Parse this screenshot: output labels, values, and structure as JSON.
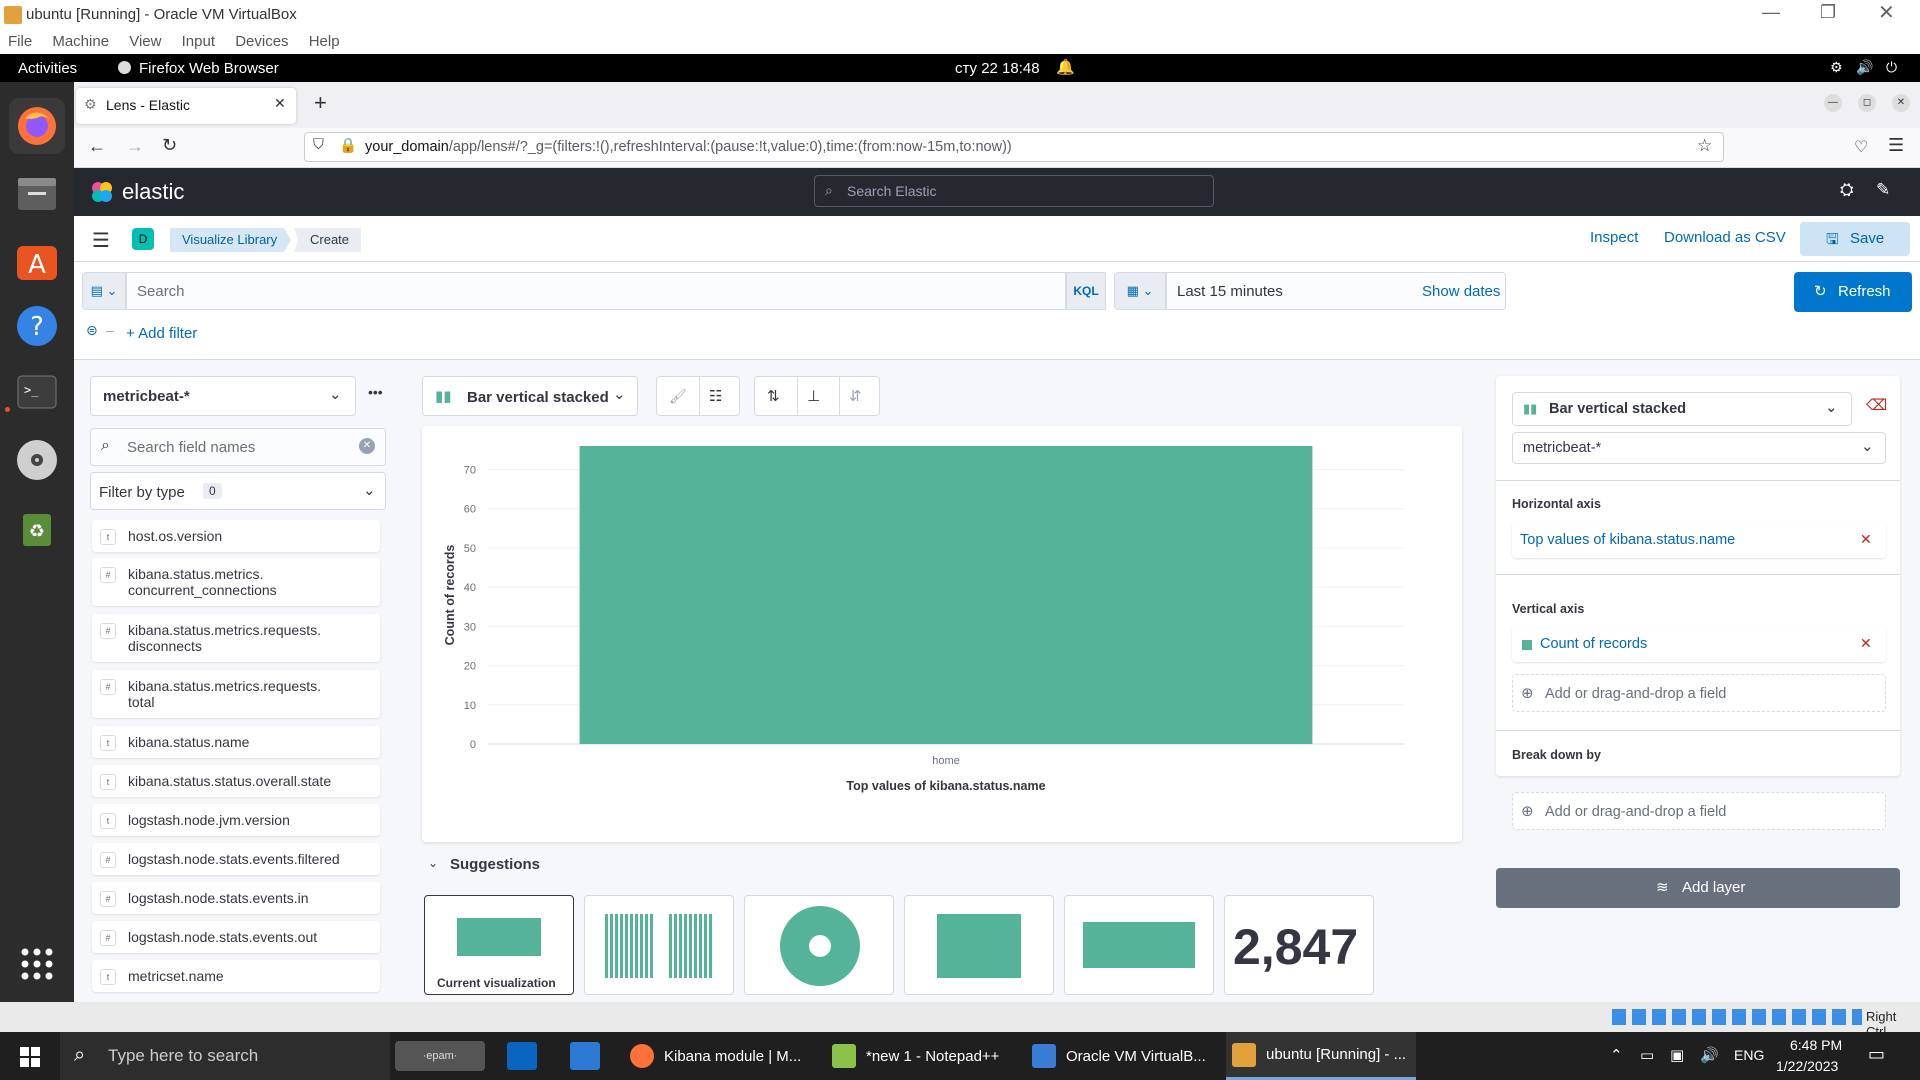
{
  "vbox": {
    "title": "ubuntu [Running] - Oracle VM VirtualBox",
    "menu": [
      "File",
      "Machine",
      "View",
      "Input",
      "Devices",
      "Help"
    ],
    "host_key": "Right Ctrl"
  },
  "gnome": {
    "activities": "Activities",
    "app": "Firefox Web Browser",
    "clock": "сту 22  18:48"
  },
  "browser": {
    "tab_title": "Lens - Elastic",
    "url_domain": "your_domain",
    "url_path": "/app/lens#/?_g=(filters:!(),refreshInterval:(pause:!t,value:0),time:(from:now-15m,to:now))"
  },
  "elastic": {
    "logo_text": "elastic",
    "search_placeholder": "Search Elastic",
    "space_badge": "D",
    "breadcrumbs": [
      "Visualize Library",
      "Create"
    ],
    "actions": {
      "inspect": "Inspect",
      "download_csv": "Download as CSV",
      "save": "Save"
    },
    "query": {
      "search_placeholder": "Search",
      "kql": "KQL",
      "time_range": "Last 15 minutes",
      "show_dates": "Show dates",
      "refresh": "Refresh",
      "add_filter": "+ Add filter"
    }
  },
  "datasource": {
    "index_pattern": "metricbeat-*",
    "field_search_placeholder": "Search field names",
    "filter_by_type": "Filter by type",
    "filter_count": "0",
    "fields": [
      {
        "type": "t",
        "name": "host.os.version"
      },
      {
        "type": "#",
        "name": "kibana.status.metrics.\nconcurrent_connections"
      },
      {
        "type": "#",
        "name": "kibana.status.metrics.requests.\ndisconnects"
      },
      {
        "type": "#",
        "name": "kibana.status.metrics.requests.\ntotal"
      },
      {
        "type": "t",
        "name": "kibana.status.name"
      },
      {
        "type": "t",
        "name": "kibana.status.status.overall.state"
      },
      {
        "type": "t",
        "name": "logstash.node.jvm.version"
      },
      {
        "type": "#",
        "name": "logstash.node.stats.events.filtered"
      },
      {
        "type": "#",
        "name": "logstash.node.stats.events.in"
      },
      {
        "type": "#",
        "name": "logstash.node.stats.events.out"
      },
      {
        "type": "t",
        "name": "metricset.name"
      }
    ]
  },
  "workspace": {
    "chart_type_label": "Bar vertical stacked",
    "suggestions_title": "Suggestions",
    "suggestion_current_label": "Current visualization",
    "suggestion_metric_value": "2,847"
  },
  "config_panel": {
    "chart_type_label": "Bar vertical stacked",
    "index_pattern": "metricbeat-*",
    "horizontal_axis_title": "Horizontal axis",
    "horizontal_axis_value": "Top values of kibana.status.name",
    "vertical_axis_title": "Vertical axis",
    "vertical_axis_value": "Count of records",
    "add_field": "Add or drag-and-drop a field",
    "break_down_title": "Break down by",
    "add_layer": "Add layer"
  },
  "taskbar": {
    "search_placeholder": "Type here to search",
    "tasks": [
      "Kibana module | M...",
      "*new 1 - Notepad++",
      "Oracle VM VirtualB...",
      "ubuntu [Running] - ..."
    ],
    "lang": "ENG",
    "time": "6:48 PM",
    "date": "1/22/2023"
  },
  "colors": {
    "accent": "#0077cc",
    "bar": "#54b399",
    "elastic_header": "#25282f"
  },
  "chart_data": {
    "type": "bar",
    "categories": [
      "home"
    ],
    "values": [
      76
    ],
    "title": "",
    "xlabel": "Top values of kibana.status.name",
    "ylabel": "Count of records",
    "ylim": [
      0,
      76
    ],
    "yticks": [
      0,
      10,
      20,
      30,
      40,
      50,
      60,
      70
    ],
    "grid": true,
    "legend": "none"
  }
}
